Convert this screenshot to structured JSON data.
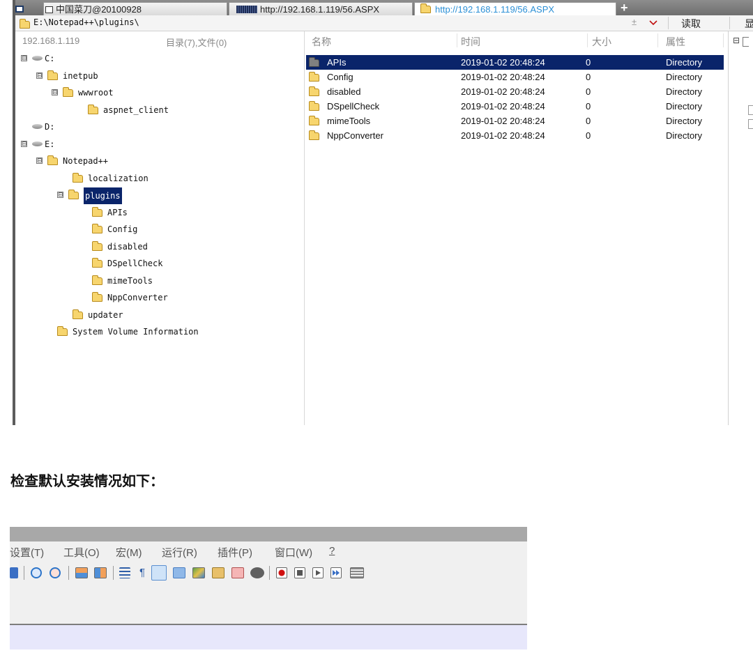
{
  "tabs": [
    {
      "label": "中国菜刀@20100928",
      "state": "inactive"
    },
    {
      "label": "http://192.168.1.119/56.ASPX",
      "state": "inactive"
    },
    {
      "label": "http://192.168.1.119/56.ASPX",
      "state": "active"
    }
  ],
  "tab_add": "+",
  "address": {
    "path": "E:\\Notepad++\\plugins\\",
    "plusminus": "±",
    "read_button": "读取",
    "show_button": "显"
  },
  "left_panel": {
    "host": "192.168.1.119",
    "summary": "目录(7),文件(0)",
    "tree": [
      {
        "label": "C:",
        "expander": "⊟",
        "icon": "drive"
      },
      {
        "label": "inetpub",
        "expander": "⊟",
        "icon": "folder"
      },
      {
        "label": "wwwroot",
        "expander": "⊟",
        "icon": "folder-open"
      },
      {
        "label": "aspnet_client",
        "expander": "",
        "icon": "folder"
      },
      {
        "label": "D:",
        "expander": "",
        "icon": "drive"
      },
      {
        "label": "E:",
        "expander": "⊟",
        "icon": "drive"
      },
      {
        "label": "Notepad++",
        "expander": "⊟",
        "icon": "folder"
      },
      {
        "label": "localization",
        "expander": "",
        "icon": "folder"
      },
      {
        "label": "plugins",
        "expander": "⊟",
        "icon": "folder-open",
        "selected": true
      },
      {
        "label": "APIs",
        "expander": "",
        "icon": "folder"
      },
      {
        "label": "Config",
        "expander": "",
        "icon": "folder"
      },
      {
        "label": "disabled",
        "expander": "",
        "icon": "folder"
      },
      {
        "label": "DSpellCheck",
        "expander": "",
        "icon": "folder"
      },
      {
        "label": "mimeTools",
        "expander": "",
        "icon": "folder"
      },
      {
        "label": "NppConverter",
        "expander": "",
        "icon": "folder"
      },
      {
        "label": "updater",
        "expander": "",
        "icon": "folder"
      },
      {
        "label": "System Volume Information",
        "expander": "",
        "icon": "folder"
      }
    ]
  },
  "file_list": {
    "headers": {
      "name": "名称",
      "time": "时间",
      "size": "大小",
      "attr": "属性"
    },
    "rows": [
      {
        "name": "APIs",
        "time": "2019-01-02 20:48:24",
        "size": "0",
        "attr": "Directory",
        "selected": true
      },
      {
        "name": "Config",
        "time": "2019-01-02 20:48:24",
        "size": "0",
        "attr": "Directory"
      },
      {
        "name": "disabled",
        "time": "2019-01-02 20:48:24",
        "size": "0",
        "attr": "Directory"
      },
      {
        "name": "DSpellCheck",
        "time": "2019-01-02 20:48:24",
        "size": "0",
        "attr": "Directory"
      },
      {
        "name": "mimeTools",
        "time": "2019-01-02 20:48:24",
        "size": "0",
        "attr": "Directory"
      },
      {
        "name": "NppConverter",
        "time": "2019-01-02 20:48:24",
        "size": "0",
        "attr": "Directory"
      }
    ]
  },
  "side_panel": {
    "expander": "⊟"
  },
  "heading": "检查默认安装情况如下：",
  "npp_screenshot": {
    "menu": [
      "设置(T)",
      "工具(O)",
      "宏(M)",
      "运行(R)",
      "插件(P)",
      "窗口(W)",
      "?"
    ],
    "toolbar_icons": [
      "zoom-in-icon",
      "zoom-out-icon",
      "sync-vertical-icon",
      "sync-horizontal-icon",
      "word-wrap-icon",
      "show-all-chars-icon",
      "indent-guide-icon",
      "udl-icon",
      "doc-map-icon",
      "function-list-icon",
      "folder-as-workspace-icon",
      "monitoring-icon",
      "record-macro-icon",
      "stop-record-icon",
      "play-macro-icon",
      "run-macro-multiple-icon",
      "save-macro-icon"
    ]
  },
  "colors": {
    "selection": "#0a246a",
    "active_tab_text": "#2a8fd6",
    "record": "#d01010"
  }
}
